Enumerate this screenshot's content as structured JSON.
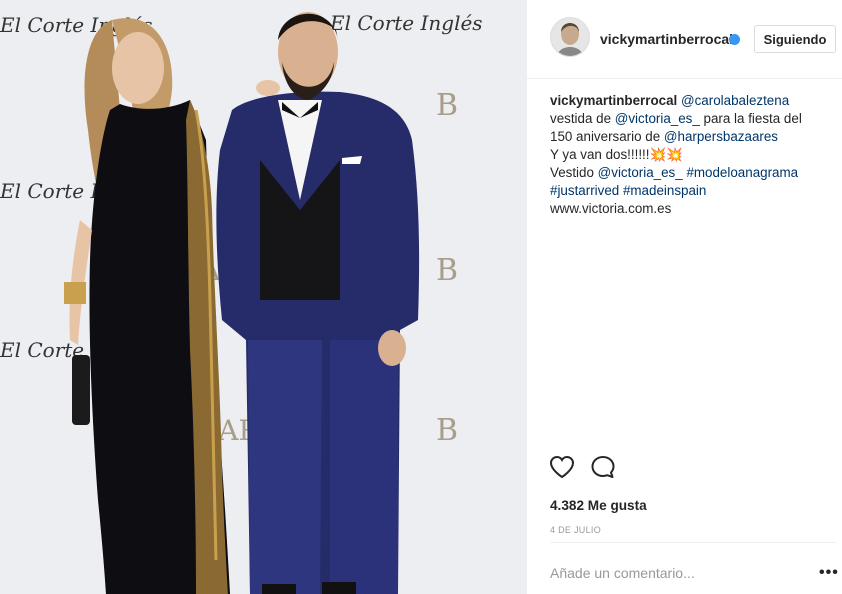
{
  "post": {
    "username": "vickymartinberrocal",
    "follow_label": "Siguiendo",
    "caption": {
      "user": "vickymartinberrocal",
      "mention1": "@carolabaleztena",
      "t1": "vestida de ",
      "mention2": "@victoria_es_",
      "t2": " para la fiesta del 150 aniversario de ",
      "mention3": "@harpersbazaares",
      "t3": "Y ya van dos!!!!!!💥💥",
      "t4": "Vestido ",
      "mention4": "@victoria_es_",
      "tag1": "#modeloanagrama",
      "tag2": "#justarrived",
      "tag3": "#madeinspain",
      "url": "www.victoria.com.es"
    },
    "likes_text": "4.382 Me gusta",
    "date_text": "4 DE JULIO",
    "comment_placeholder": "Añade un comentario...",
    "more_label": "•••"
  },
  "photo": {
    "backdrop_text_1": "El Corte Inglés",
    "backdrop_text_2": "BAZAAR"
  },
  "icons": {
    "heart": "heart-icon",
    "comment": "comment-icon",
    "verified": "verified-badge-icon",
    "more": "more-options-icon"
  },
  "colors": {
    "link": "#003569",
    "verified": "#3897f0",
    "text": "#262626",
    "muted": "#999999"
  }
}
